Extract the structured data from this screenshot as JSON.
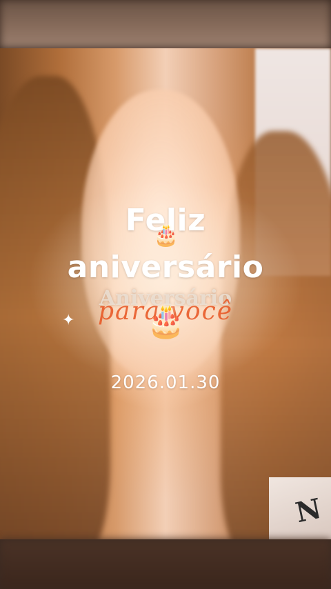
{
  "greeting": {
    "line1": "Feliz",
    "line2": "aniversário"
  },
  "sticker": {
    "word": "Aniversário",
    "script": "para você"
  },
  "date": "2026.01.30",
  "decor": {
    "cake_icon": "🎂",
    "sparkle_icon": "✦",
    "shirt_mark": "N"
  },
  "colors": {
    "title": "#ffffff",
    "script_accent": "#e85a28"
  }
}
